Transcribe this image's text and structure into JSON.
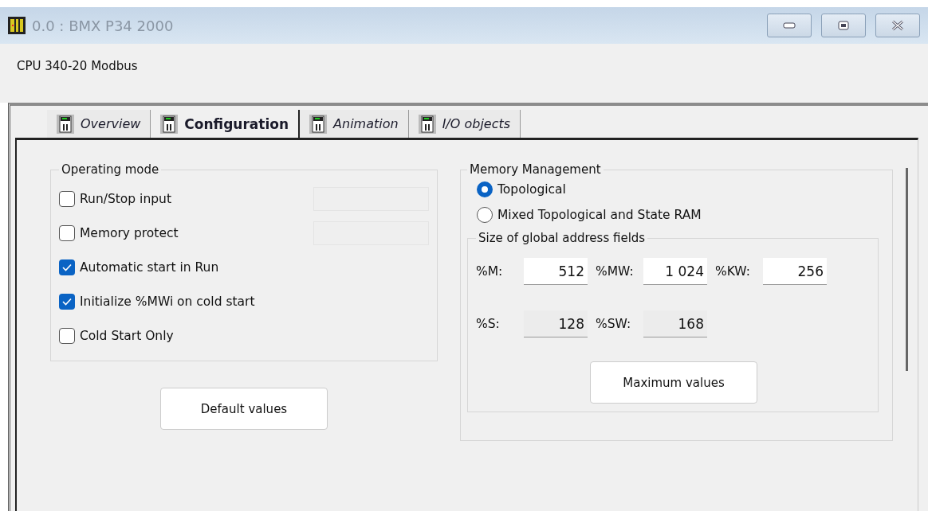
{
  "window": {
    "title": "0.0 : BMX P34 2000"
  },
  "header": {
    "module": "CPU 340-20 Modbus"
  },
  "tabs": [
    {
      "label": "Overview",
      "selected": false
    },
    {
      "label": "Configuration",
      "selected": true
    },
    {
      "label": "Animation",
      "selected": false
    },
    {
      "label": "I/O objects",
      "selected": false
    }
  ],
  "operating_mode": {
    "title": "Operating mode",
    "options": [
      {
        "label": "Run/Stop input",
        "checked": false,
        "has_field": true
      },
      {
        "label": "Memory protect",
        "checked": false,
        "has_field": true
      },
      {
        "label": "Automatic start in Run",
        "checked": true,
        "has_field": false
      },
      {
        "label": "Initialize %MWi on cold start",
        "checked": true,
        "has_field": false
      },
      {
        "label": "Cold Start Only",
        "checked": false,
        "has_field": false
      }
    ],
    "button": "Default values"
  },
  "memory_management": {
    "title": "Memory Management",
    "options": [
      {
        "label": "Topological",
        "selected": true
      },
      {
        "label": "Mixed Topological and State RAM",
        "selected": false
      }
    ],
    "address_fields": {
      "title": "Size of global address fields",
      "rows": [
        [
          {
            "label": "%M:",
            "value": "512",
            "disabled": false
          },
          {
            "label": "%MW:",
            "value": "1 024",
            "disabled": false
          },
          {
            "label": "%KW:",
            "value": "256",
            "disabled": false
          }
        ],
        [
          {
            "label": "%S:",
            "value": "128",
            "disabled": true
          },
          {
            "label": "%SW:",
            "value": "168",
            "disabled": true
          }
        ]
      ]
    },
    "button": "Maximum values"
  }
}
